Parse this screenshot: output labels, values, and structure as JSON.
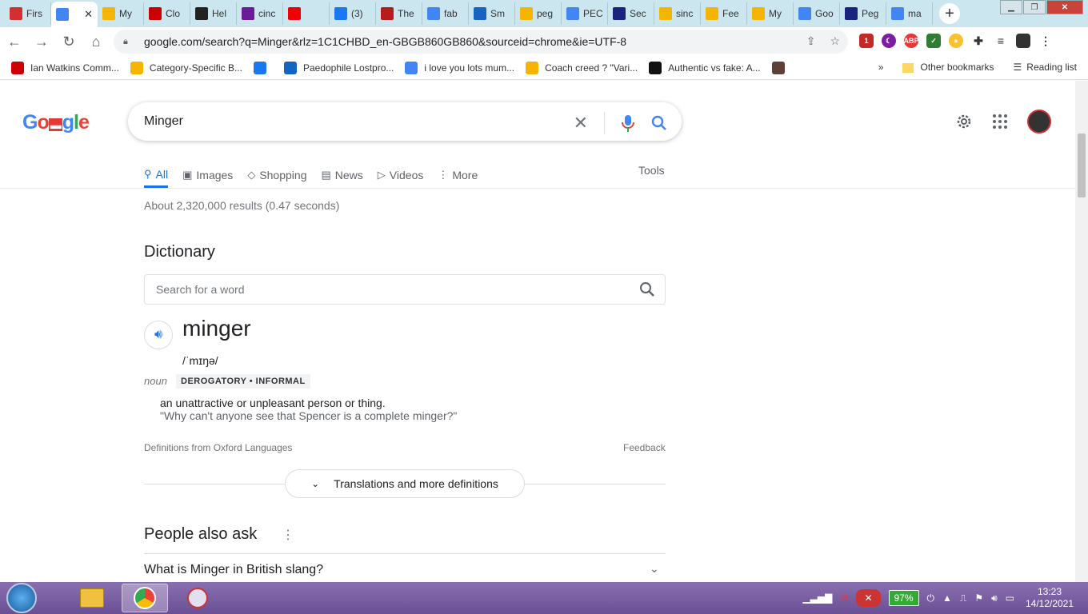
{
  "tabs": [
    {
      "label": "Firs",
      "color": "#d32f2f"
    },
    {
      "label": "",
      "color": "#4285f4",
      "active": true
    },
    {
      "label": "My",
      "color": "#f4b400"
    },
    {
      "label": "Clo",
      "color": "#c00"
    },
    {
      "label": "Hel",
      "color": "#222"
    },
    {
      "label": "cinc",
      "color": "#6a1b9a"
    },
    {
      "label": "",
      "color": "#e00"
    },
    {
      "label": "(3)",
      "color": "#1877f2"
    },
    {
      "label": "The",
      "color": "#b71c1c"
    },
    {
      "label": "fab",
      "color": "#4285f4"
    },
    {
      "label": "Sm",
      "color": "#1565c0"
    },
    {
      "label": "peg",
      "color": "#f4b400"
    },
    {
      "label": "PEC",
      "color": "#4285f4"
    },
    {
      "label": "Sec",
      "color": "#1a237e"
    },
    {
      "label": "sinc",
      "color": "#f4b400"
    },
    {
      "label": "Fee",
      "color": "#f4b400"
    },
    {
      "label": "My",
      "color": "#f4b400"
    },
    {
      "label": "Goo",
      "color": "#4285f4"
    },
    {
      "label": "Peg",
      "color": "#1a237e"
    },
    {
      "label": "ma",
      "color": "#4285f4"
    }
  ],
  "address": {
    "url": "google.com/search?q=Minger&rlz=1C1CHBD_en-GBGB860GB860&sourceid=chrome&ie=UTF-8"
  },
  "bookmarks": [
    {
      "label": "Ian Watkins Comm...",
      "color": "#c00"
    },
    {
      "label": "Category-Specific B...",
      "color": "#f4b400"
    },
    {
      "label": "",
      "color": "#1877f2"
    },
    {
      "label": "Paedophile Lostpro...",
      "color": "#1565c0"
    },
    {
      "label": "i love you lots mum...",
      "color": "#4285f4"
    },
    {
      "label": "Coach creed ? \"Vari...",
      "color": "#f4b400"
    },
    {
      "label": "Authentic vs fake: A...",
      "color": "#111"
    },
    {
      "label": "",
      "color": "#5d4037"
    }
  ],
  "bookmarks_right": {
    "more": "»",
    "other": "Other bookmarks",
    "reading": "Reading list"
  },
  "search": {
    "query": "Minger"
  },
  "nav_tabs": [
    {
      "label": "All",
      "icon": "⚲"
    },
    {
      "label": "Images",
      "icon": "▣"
    },
    {
      "label": "Shopping",
      "icon": "◇"
    },
    {
      "label": "News",
      "icon": "▤"
    },
    {
      "label": "Videos",
      "icon": "▷"
    },
    {
      "label": "More",
      "icon": "⋮"
    }
  ],
  "tools_label": "Tools",
  "stats": "About 2,320,000 results (0.47 seconds)",
  "dictionary": {
    "title": "Dictionary",
    "search_placeholder": "Search for a word",
    "word": "minger",
    "phonetic": "/ˈmɪŋə/",
    "pos": "noun",
    "label": "DEROGATORY • INFORMAL",
    "definition": "an unattractive or unpleasant person or thing.",
    "example": "\"Why can't anyone see that Spencer is a complete minger?\"",
    "source": "Definitions from Oxford Languages",
    "feedback": "Feedback",
    "expand": "Translations and more definitions"
  },
  "paa": {
    "title": "People also ask",
    "questions": [
      "What is Minger in British slang?"
    ]
  },
  "tray": {
    "battery": "97%",
    "time": "13:23",
    "date": "14/12/2021"
  }
}
